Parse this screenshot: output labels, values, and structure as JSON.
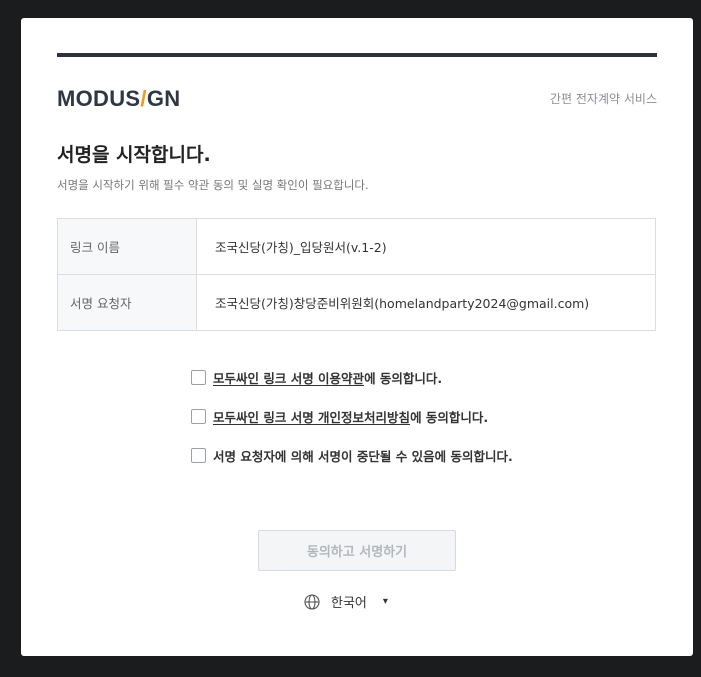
{
  "header": {
    "brand_prefix": "MODUS",
    "brand_slash": "/",
    "brand_suffix": "GN",
    "service": "간편 전자계약 서비스"
  },
  "intro": {
    "title": "서명을 시작합니다.",
    "subtitle": "서명을 시작하기 위해 필수 약관 동의 및 실명 확인이 필요합니다."
  },
  "info": {
    "rows": [
      {
        "label": "링크 이름",
        "value": "조국신당(가칭)_입당원서(v.1-2)"
      },
      {
        "label": "서명 요청자",
        "value": "조국신당(가칭)창당준비위원회(homelandparty2024@gmail.com)"
      }
    ]
  },
  "agreements": [
    {
      "link": "모두싸인 링크 서명 이용약관",
      "suffix": "에 동의합니다.",
      "checked": false
    },
    {
      "link": "모두싸인 링크 서명 개인정보처리방침",
      "suffix": "에 동의합니다.",
      "checked": false
    },
    {
      "text": "서명 요청자에 의해 서명이 중단될 수 있음에 동의합니다.",
      "checked": false
    }
  ],
  "actions": {
    "submit_label": "동의하고 서명하기",
    "submit_enabled": false
  },
  "language": {
    "current": "한국어",
    "icon": "globe-icon",
    "caret": "▾"
  },
  "colors": {
    "brand_text": "#2e3744",
    "brand_accent": "#f29a1d",
    "disabled_text": "#b3b7bc"
  }
}
